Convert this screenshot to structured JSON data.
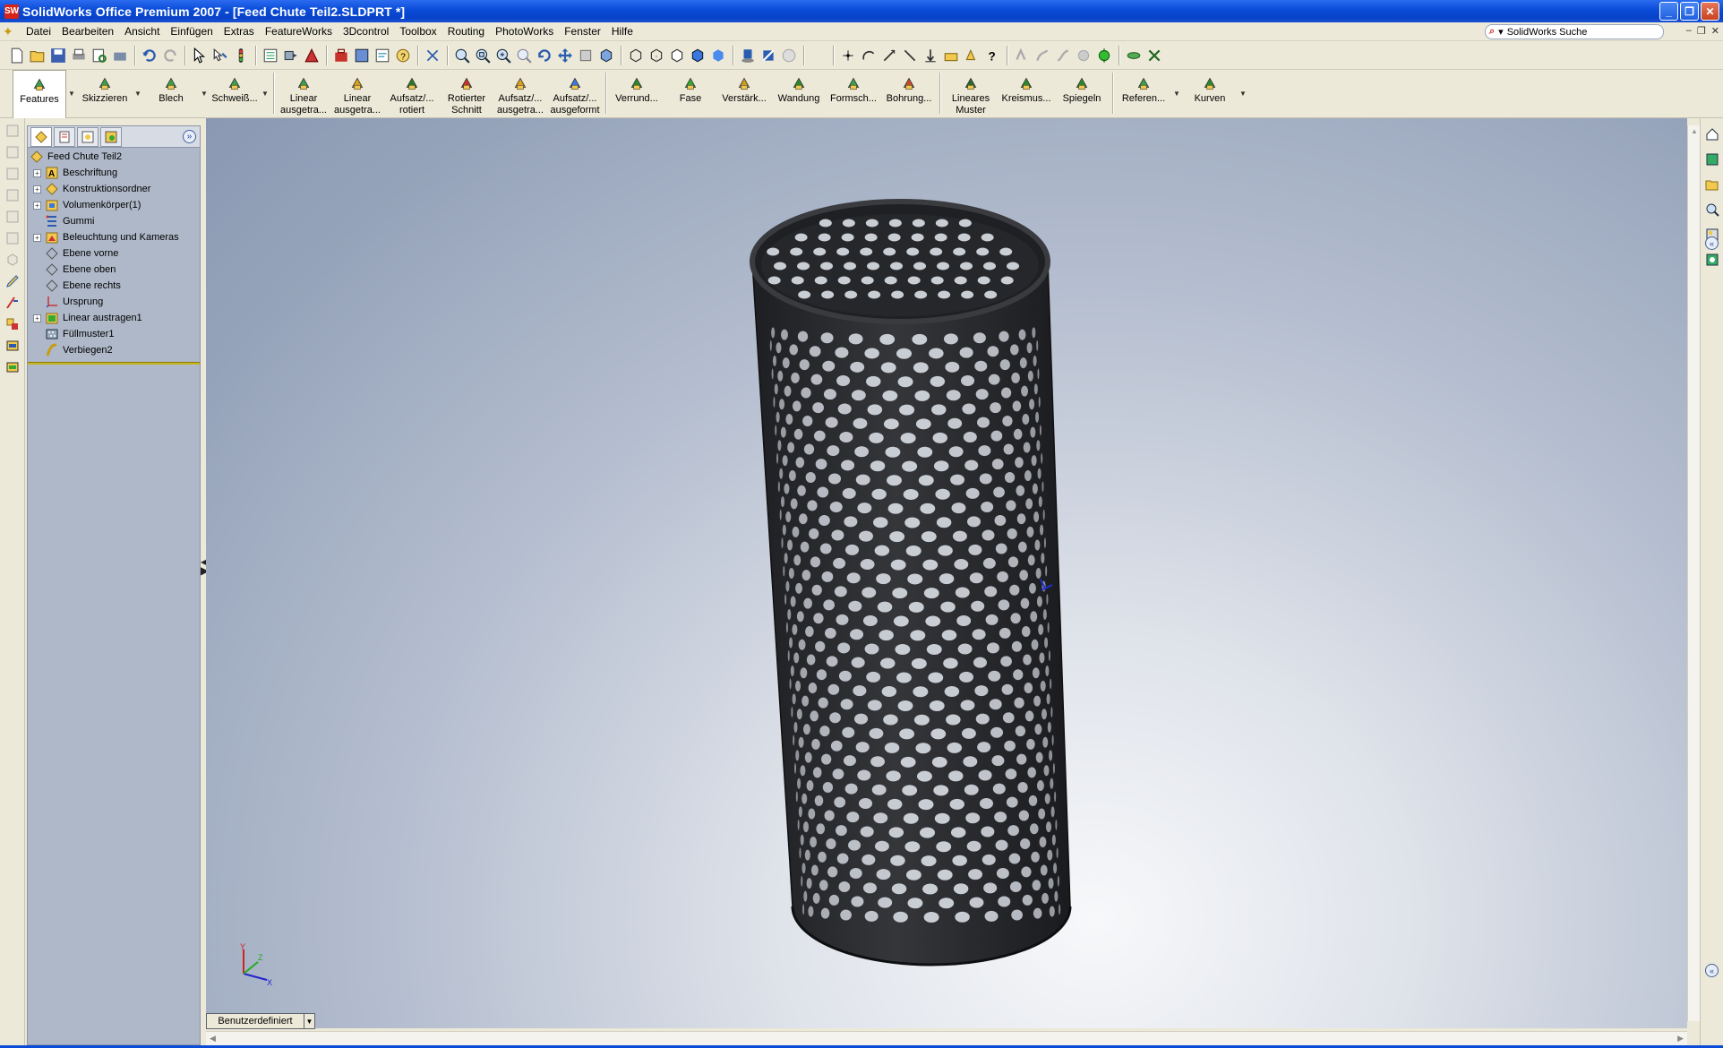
{
  "window": {
    "title": "SolidWorks Office Premium 2007 - [Feed Chute Teil2.SLDPRT *]",
    "app_icon": "SW",
    "controls": {
      "minimize": "_",
      "restore": "❐",
      "close": "✕"
    }
  },
  "menu": {
    "items": [
      "Datei",
      "Bearbeiten",
      "Ansicht",
      "Einfügen",
      "Extras",
      "FeatureWorks",
      "3Dcontrol",
      "Toolbox",
      "Routing",
      "PhotoWorks",
      "Fenster",
      "Hilfe"
    ]
  },
  "search": {
    "placeholder": "SolidWorks Suche",
    "brand": "▾"
  },
  "command_manager": {
    "tabs": [
      {
        "label": "Features",
        "icon": "features-icon",
        "active": true
      },
      {
        "label": "Skizzieren",
        "icon": "sketch-icon"
      },
      {
        "label": "Blech",
        "icon": "sheetmetal-icon"
      },
      {
        "label": "Schweiß...",
        "icon": "weldment-icon"
      }
    ],
    "commands": [
      {
        "label1": "Linear",
        "label2": "ausgetra...",
        "icon": "extruded-boss-icon"
      },
      {
        "label1": "Linear",
        "label2": "ausgetra...",
        "icon": "extruded-cut-icon"
      },
      {
        "label1": "Aufsatz/...",
        "label2": "rotiert",
        "icon": "revolved-boss-icon"
      },
      {
        "label1": "Rotierter",
        "label2": "Schnitt",
        "icon": "revolved-cut-icon"
      },
      {
        "label1": "Aufsatz/...",
        "label2": "ausgetra...",
        "icon": "swept-boss-icon"
      },
      {
        "label1": "Aufsatz/...",
        "label2": "ausgeformt",
        "icon": "lofted-boss-icon"
      },
      {
        "label1": "Verrund...",
        "label2": "",
        "icon": "fillet-icon"
      },
      {
        "label1": "Fase",
        "label2": "",
        "icon": "chamfer-icon"
      },
      {
        "label1": "Verstärk...",
        "label2": "",
        "icon": "rib-icon"
      },
      {
        "label1": "Wandung",
        "label2": "",
        "icon": "shell-icon"
      },
      {
        "label1": "Formsch...",
        "label2": "",
        "icon": "draft-icon"
      },
      {
        "label1": "Bohrung...",
        "label2": "",
        "icon": "hole-wizard-icon"
      },
      {
        "label1": "Lineares",
        "label2": "Muster",
        "icon": "linear-pattern-icon"
      },
      {
        "label1": "Kreismus...",
        "label2": "",
        "icon": "circular-pattern-icon"
      },
      {
        "label1": "Spiegeln",
        "label2": "",
        "icon": "mirror-icon"
      },
      {
        "label1": "Referen...",
        "label2": "",
        "icon": "reference-geometry-icon"
      },
      {
        "label1": "Kurven",
        "label2": "",
        "icon": "curves-icon"
      }
    ]
  },
  "feature_tree": {
    "root": "Feed Chute Teil2",
    "items": [
      {
        "label": "Beschriftung",
        "icon": "annotations-icon",
        "expandable": true
      },
      {
        "label": "Konstruktionsordner",
        "icon": "design-binder-icon",
        "expandable": true
      },
      {
        "label": "Volumenkörper(1)",
        "icon": "solid-bodies-icon",
        "expandable": true
      },
      {
        "label": "Gummi",
        "icon": "material-icon",
        "expandable": false
      },
      {
        "label": "Beleuchtung und Kameras",
        "icon": "lights-cameras-icon",
        "expandable": true
      },
      {
        "label": "Ebene vorne",
        "icon": "plane-icon",
        "expandable": false
      },
      {
        "label": "Ebene oben",
        "icon": "plane-icon",
        "expandable": false
      },
      {
        "label": "Ebene rechts",
        "icon": "plane-icon",
        "expandable": false
      },
      {
        "label": "Ursprung",
        "icon": "origin-icon",
        "expandable": false
      },
      {
        "label": "Linear austragen1",
        "icon": "extrude-feature-icon",
        "expandable": true
      },
      {
        "label": "Füllmuster1",
        "icon": "fill-pattern-icon",
        "expandable": false
      },
      {
        "label": "Verbiegen2",
        "icon": "flex-icon",
        "expandable": false
      }
    ]
  },
  "viewport": {
    "view_orientation": "Benutzerdefiniert",
    "model": "perforated-cylinder",
    "colors": {
      "model": "#2b2c2f",
      "hole": "#c9cdd4",
      "bg_center": "#f7f8fa",
      "bg_edge": "#8a98b2"
    }
  },
  "triad": {
    "x": "X",
    "y": "Y",
    "z": "Z"
  }
}
